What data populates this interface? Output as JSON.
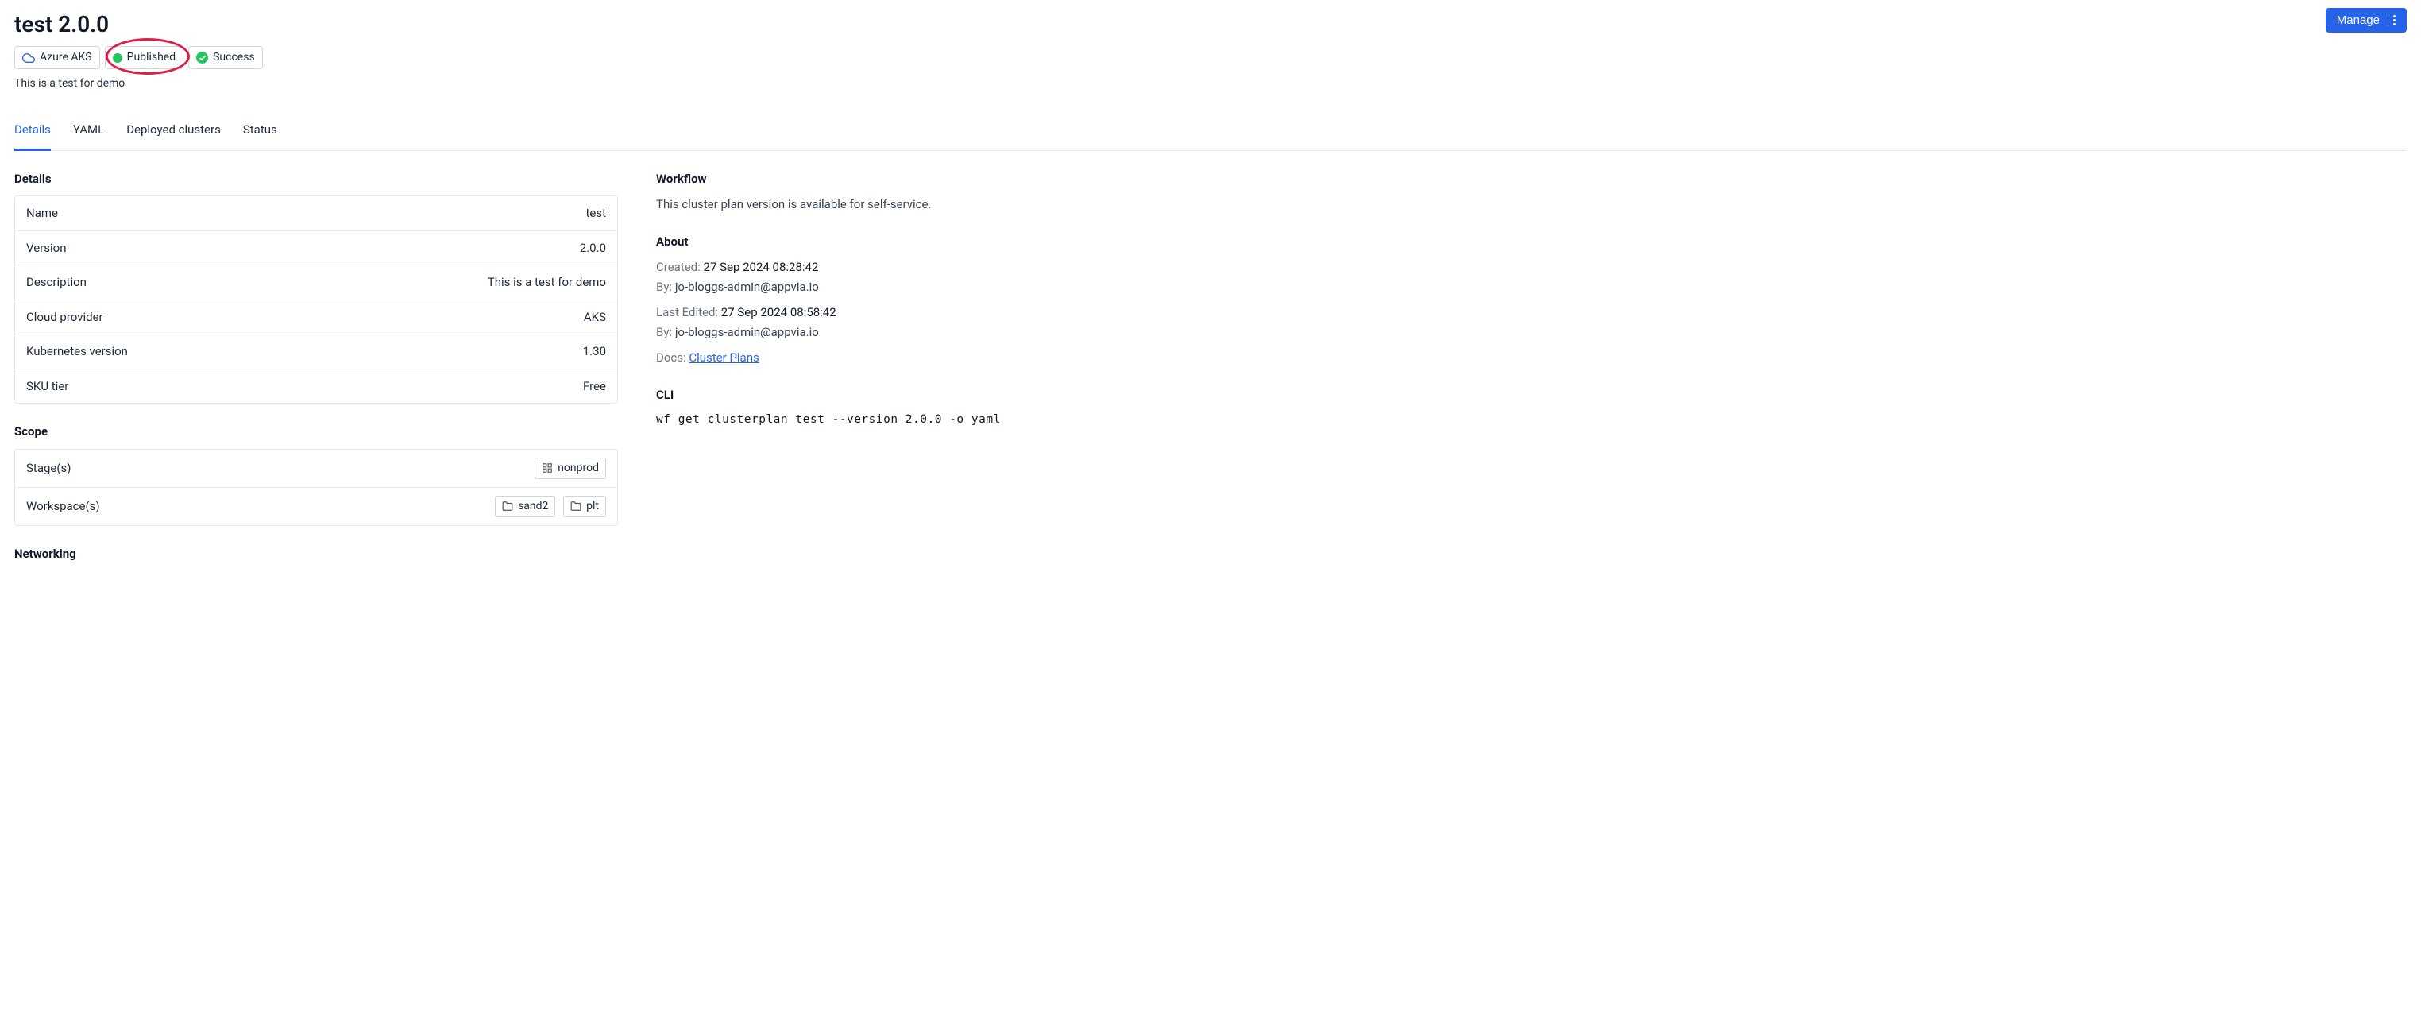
{
  "header": {
    "title": "test 2.0.0",
    "manage_label": "Manage",
    "badges": {
      "provider": "Azure AKS",
      "published": "Published",
      "success": "Success"
    },
    "subtitle": "This is a test for demo"
  },
  "tabs": [
    {
      "label": "Details",
      "active": true
    },
    {
      "label": "YAML",
      "active": false
    },
    {
      "label": "Deployed clusters",
      "active": false
    },
    {
      "label": "Status",
      "active": false
    }
  ],
  "details": {
    "heading": "Details",
    "rows": [
      {
        "key": "Name",
        "value": "test"
      },
      {
        "key": "Version",
        "value": "2.0.0"
      },
      {
        "key": "Description",
        "value": "This is a test for demo"
      },
      {
        "key": "Cloud provider",
        "value": "AKS"
      },
      {
        "key": "Kubernetes version",
        "value": "1.30"
      },
      {
        "key": "SKU tier",
        "value": "Free"
      }
    ]
  },
  "scope": {
    "heading": "Scope",
    "stages_label": "Stage(s)",
    "stages": [
      "nonprod"
    ],
    "workspaces_label": "Workspace(s)",
    "workspaces": [
      "sand2",
      "plt"
    ]
  },
  "networking": {
    "heading": "Networking"
  },
  "workflow": {
    "heading": "Workflow",
    "text": "This cluster plan version is available for self-service."
  },
  "about": {
    "heading": "About",
    "created_label": "Created:",
    "created_value": "27 Sep 2024 08:28:42",
    "created_by_label": "By:",
    "created_by_value": "jo-bloggs-admin@appvia.io",
    "edited_label": "Last Edited:",
    "edited_value": "27 Sep 2024 08:58:42",
    "edited_by_label": "By:",
    "edited_by_value": "jo-bloggs-admin@appvia.io",
    "docs_label": "Docs:",
    "docs_link": "Cluster Plans"
  },
  "cli": {
    "heading": "CLI",
    "command": "wf get clusterplan test --version 2.0.0 -o yaml"
  }
}
